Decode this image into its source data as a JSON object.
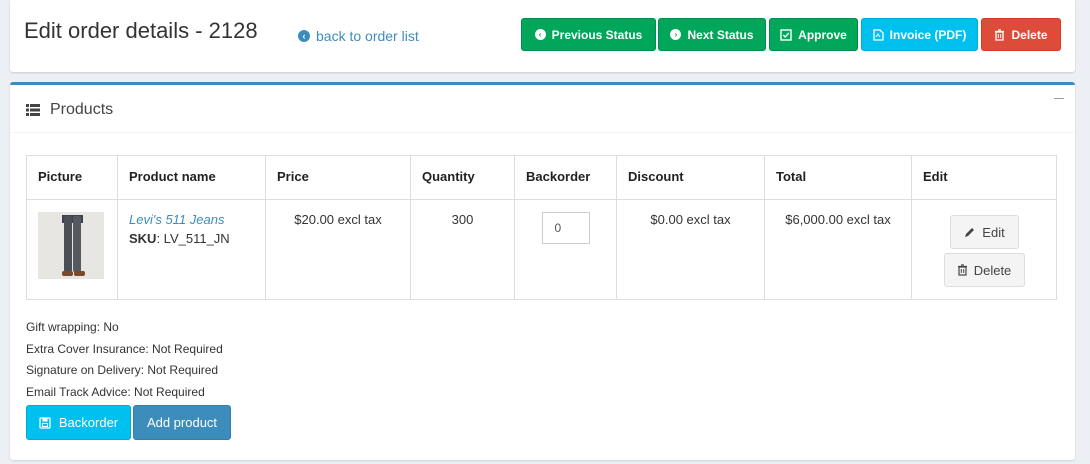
{
  "header": {
    "title": "Edit order details - 2128",
    "back_link": "back to order list",
    "actions": {
      "previous_status": "Previous Status",
      "next_status": "Next Status",
      "approve": "Approve",
      "invoice": "Invoice (PDF)",
      "delete": "Delete"
    }
  },
  "products_box": {
    "title": "Products",
    "columns": [
      "Picture",
      "Product name",
      "Price",
      "Quantity",
      "Backorder",
      "Discount",
      "Total",
      "Edit"
    ],
    "rows": [
      {
        "product_name": "Levi's 511 Jeans",
        "sku_label": "SKU",
        "sku_value": ": LV_511_JN",
        "price": "$20.00 excl tax",
        "quantity": "300",
        "backorder": "0",
        "discount": "$0.00 excl tax",
        "total": "$6,000.00 excl tax",
        "edit_label": "Edit",
        "delete_label": "Delete"
      }
    ],
    "options": [
      "Gift wrapping: No",
      "Extra Cover Insurance: Not Required",
      "Signature on Delivery: Not Required",
      "Email Track Advice: Not Required"
    ],
    "backorder_button": "Backorder",
    "add_product_button": "Add product"
  },
  "colors": {
    "green": "#00a65a",
    "cyan": "#00c0ef",
    "red": "#dd4b39",
    "primary": "#3c8dbc"
  }
}
